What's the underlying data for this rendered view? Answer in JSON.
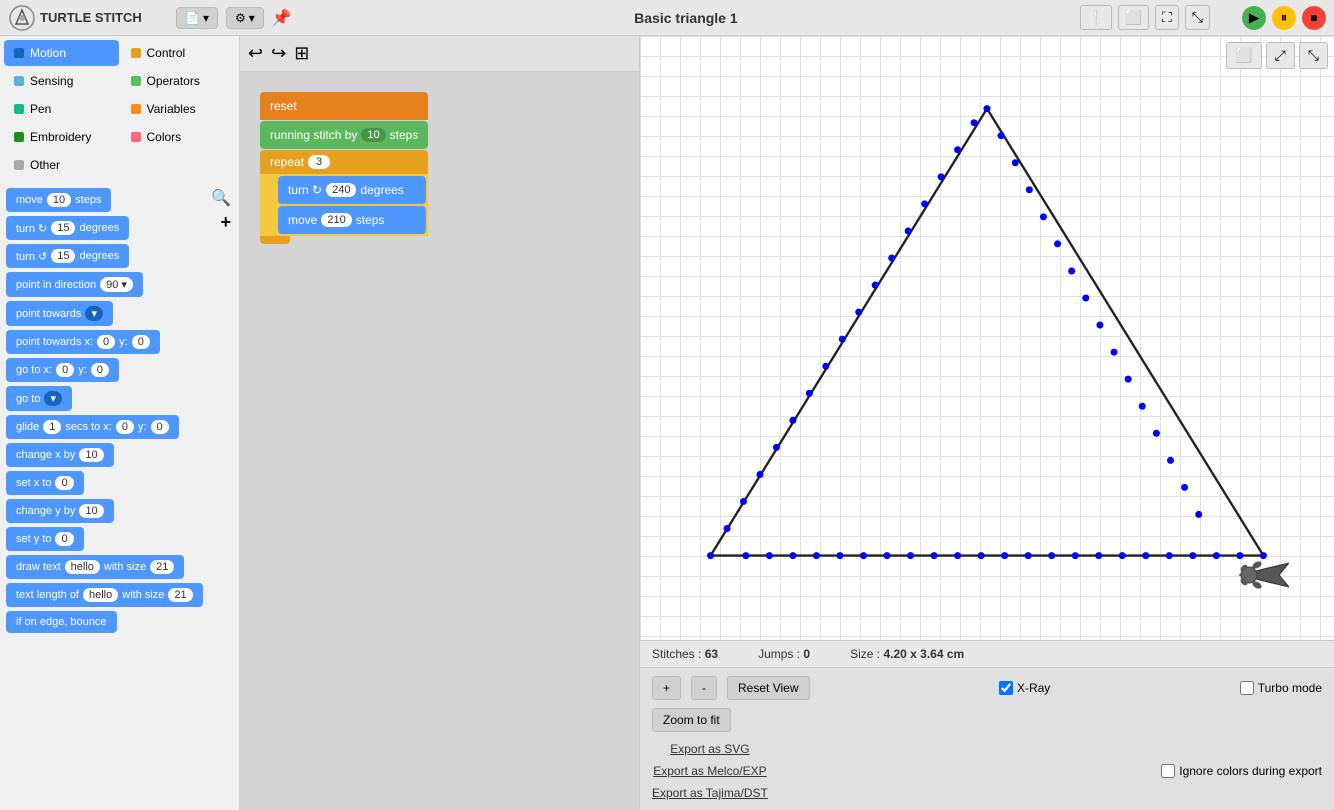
{
  "app": {
    "name": "TURTLE STITCH",
    "title": "Basic triangle 1"
  },
  "toolbar": {
    "file_btn": "▾",
    "settings_btn": "⚙ ▾",
    "pin_btn": "📌",
    "undo_btn": "↩",
    "redo_btn": "↪",
    "grid_btn": "⊞",
    "fullscreen_btn": "⛶",
    "expand_btn": "⤢",
    "shrink_btn": "⤡",
    "play_btn": "▶",
    "pause_btn": "⏸",
    "stop_btn": "●"
  },
  "categories": [
    {
      "id": "motion",
      "label": "Motion",
      "color": "#4d97ff",
      "active": true
    },
    {
      "id": "control",
      "label": "Control",
      "color": "#e6a020"
    },
    {
      "id": "sensing",
      "label": "Sensing",
      "color": "#5cb1d6"
    },
    {
      "id": "operators",
      "label": "Operators",
      "color": "#59c059"
    },
    {
      "id": "pen",
      "label": "Pen",
      "color": "#0fbd8c"
    },
    {
      "id": "variables",
      "label": "Variables",
      "color": "#ff8c1a"
    },
    {
      "id": "embroidery",
      "label": "Embroidery",
      "color": "#228b22"
    },
    {
      "id": "colors",
      "label": "Colors",
      "color": "#ff6680"
    },
    {
      "id": "other",
      "label": "Other",
      "color": "#aaa"
    }
  ],
  "blocks": [
    {
      "id": "move",
      "label": "move",
      "val1": "10",
      "suffix": "steps"
    },
    {
      "id": "turn-cw",
      "label": "turn ↻",
      "val1": "15",
      "suffix": "degrees"
    },
    {
      "id": "turn-ccw",
      "label": "turn ↺",
      "val1": "15",
      "suffix": "degrees"
    },
    {
      "id": "point-direction",
      "label": "point in direction",
      "val1": "90",
      "dropdown": true
    },
    {
      "id": "point-towards",
      "label": "point towards",
      "dropdown": true
    },
    {
      "id": "point-towards-xy",
      "label": "point towards x:",
      "val1": "0",
      "mid": "y:",
      "val2": "0"
    },
    {
      "id": "go-to-xy",
      "label": "go to x:",
      "val1": "0",
      "mid": "y:",
      "val2": "0"
    },
    {
      "id": "go-to",
      "label": "go to",
      "dropdown": true
    },
    {
      "id": "glide",
      "label": "glide",
      "val1": "1",
      "mid2": "secs to x:",
      "val2": "0",
      "mid3": "y:",
      "val3": "0"
    },
    {
      "id": "change-x",
      "label": "change x by",
      "val1": "10"
    },
    {
      "id": "set-x",
      "label": "set x to",
      "val1": "0"
    },
    {
      "id": "change-y",
      "label": "change y by",
      "val1": "10"
    },
    {
      "id": "set-y",
      "label": "set y to",
      "val1": "0"
    },
    {
      "id": "draw-text",
      "label": "draw text",
      "val1": "hello",
      "mid": "with size",
      "val2": "21"
    },
    {
      "id": "text-length",
      "label": "text length of",
      "val1": "hello",
      "mid": "with size",
      "val2": "21"
    },
    {
      "id": "if-edge",
      "label": "if on edge, bounce"
    }
  ],
  "script": {
    "blocks": [
      {
        "type": "reset",
        "label": "reset",
        "color": "orange"
      },
      {
        "type": "running-stitch",
        "label": "running stitch by",
        "val": "10",
        "suffix": "steps",
        "color": "green"
      },
      {
        "type": "repeat",
        "label": "repeat",
        "val": "3",
        "color": "yellow",
        "inner": [
          {
            "type": "turn",
            "label": "turn ↻",
            "val": "240",
            "suffix": "degrees"
          },
          {
            "type": "move",
            "label": "move",
            "val": "210",
            "suffix": "steps"
          }
        ]
      }
    ]
  },
  "canvas": {
    "stitches_label": "Stitches :",
    "stitches_val": "63",
    "jumps_label": "Jumps :",
    "jumps_val": "0",
    "size_label": "Size :",
    "size_val": "4.20 x 3.64 cm"
  },
  "controls": {
    "plus_btn": "+",
    "minus_btn": "-",
    "reset_view_btn": "Reset View",
    "zoom_fit_btn": "Zoom to fit",
    "xray_label": "X-Ray",
    "turbo_label": "Turbo mode",
    "export_svg_btn": "Export as SVG",
    "export_melco_btn": "Export as Melco/EXP",
    "export_tajima_btn": "Export as Tajima/DST",
    "ignore_colors_label": "Ignore colors during export"
  }
}
